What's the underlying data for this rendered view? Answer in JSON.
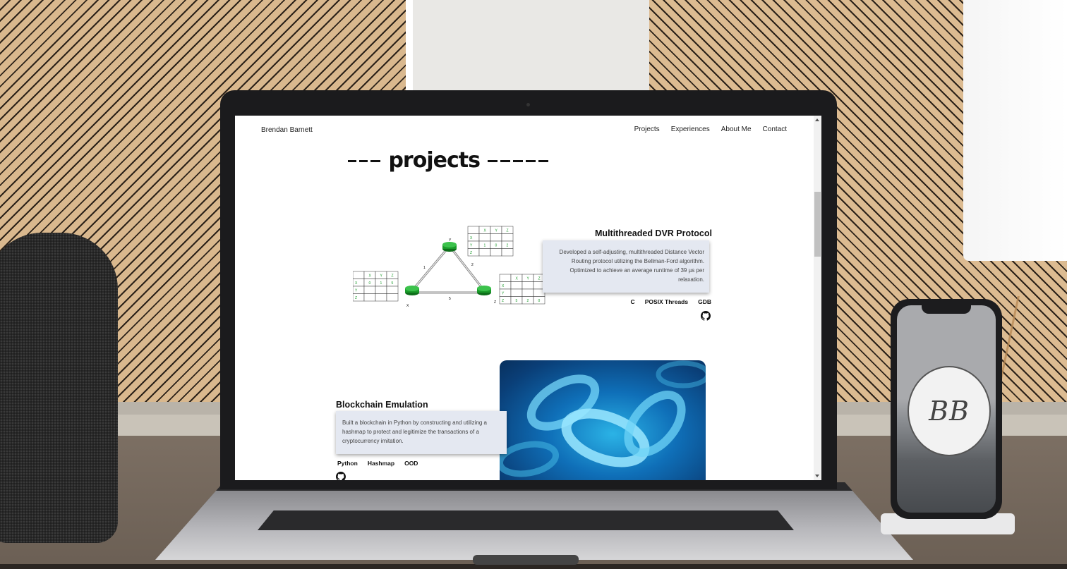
{
  "nav": {
    "brand": "Brendan Barnett",
    "links": [
      "Projects",
      "Experiences",
      "About Me",
      "Contact"
    ]
  },
  "section_title": "projects",
  "projects": [
    {
      "title": "Multithreaded DVR Protocol",
      "description": "Developed a self-adjusting, multithreaded Distance Vector Routing protocol utilizing the Bellman-Ford algorithm. Optimized to achieve an average runtime of 39 µs per relaxation.",
      "tags": [
        "C",
        "POSIX Threads",
        "GDB"
      ]
    },
    {
      "title": "Blockchain Emulation",
      "description": "Built a blockchain in Python by constructing and utilizing a hashmap to protect and legitimize the transactions of a cryptocurrency imitation.",
      "tags": [
        "Python",
        "Hashmap",
        "OOD"
      ]
    }
  ],
  "diagram": {
    "nodes": [
      "X",
      "Y",
      "Z"
    ],
    "edge_weights": {
      "xy": "1",
      "yz": "2",
      "xz": "5"
    },
    "table_x": [
      [
        "",
        "X",
        "Y",
        "Z"
      ],
      [
        "X",
        "0",
        "1",
        "5"
      ],
      [
        "Y",
        "",
        "",
        ""
      ],
      [
        "Z",
        "",
        "",
        ""
      ]
    ],
    "table_y": [
      [
        "",
        "X",
        "Y",
        "Z"
      ],
      [
        "X",
        "",
        "",
        ""
      ],
      [
        "Y",
        "1",
        "0",
        "2"
      ],
      [
        "Z",
        "",
        "",
        ""
      ]
    ],
    "table_z": [
      [
        "",
        "X",
        "Y",
        "Z"
      ],
      [
        "X",
        "",
        "",
        ""
      ],
      [
        "Y",
        "",
        "",
        ""
      ],
      [
        "Z",
        "5",
        "2",
        "0"
      ]
    ]
  },
  "phone_logo": "BB",
  "colors": {
    "card_bg": "#e4e8f1",
    "router_green": "#1a9a2a",
    "table_text": "#1a9a2a"
  }
}
